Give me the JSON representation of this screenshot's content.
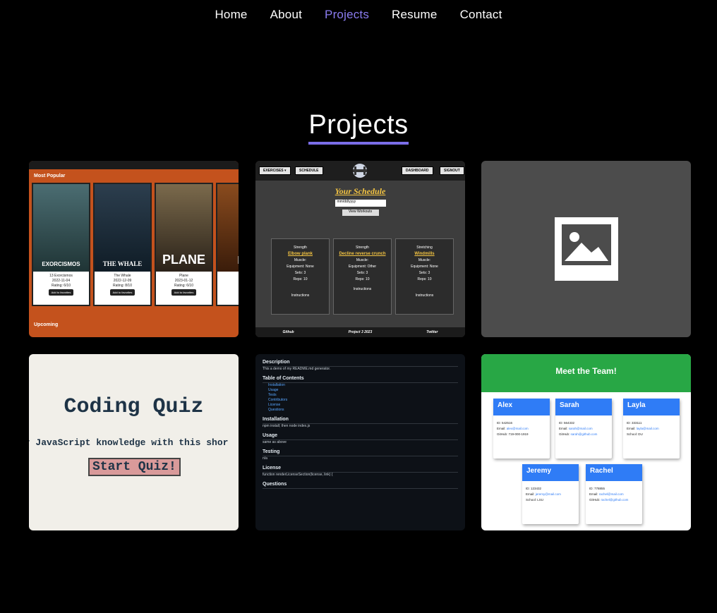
{
  "nav": {
    "items": [
      "Home",
      "About",
      "Projects",
      "Resume",
      "Contact"
    ],
    "active": "Projects"
  },
  "page_title": "Projects",
  "colors": {
    "accent": "#7b6ee8",
    "active_link": "#8a7cf0",
    "background": "#000000"
  },
  "projects": [
    {
      "sections": [
        "Most Popular",
        "Upcoming"
      ],
      "movies": [
        {
          "title": "13 Exorcismos",
          "poster_text": "EXORCISMOS",
          "date": "2022-11-04",
          "rating": "Rating: 6/10"
        },
        {
          "title": "The Whale",
          "poster_text": "THE WHALE",
          "date": "2022-12-09",
          "rating": "Rating: 8/10"
        },
        {
          "title": "Plane",
          "poster_text": "PLANE",
          "date": "2023-01-12",
          "rating": "Rating: 6/10"
        },
        {
          "title": "",
          "poster_text": "DE",
          "date": "",
          "rating": ""
        }
      ],
      "favorite_button": "Add to favorites"
    },
    {
      "nav": [
        "EXERCISES ▾",
        "SCHEDULE",
        "DASHBOARD",
        "SIGNOUT"
      ],
      "heading": "Your Schedule",
      "date_placeholder": "mm/dd/yyyy",
      "view_button": "View Workouts",
      "exercises": [
        {
          "type": "Strength",
          "name": "Elbow plank",
          "muscle": "Muscle:",
          "equipment": "Equipment: None",
          "sets": "Sets: 3",
          "reps": "Reps: 10"
        },
        {
          "type": "Strength",
          "name": "Decline reverse crunch",
          "muscle": "Muscle:",
          "equipment": "Equipment: Other",
          "sets": "Sets: 3",
          "reps": "Reps: 10"
        },
        {
          "type": "Stretching",
          "name": "Windmills",
          "muscle": "Muscle:",
          "equipment": "Equipment: None",
          "sets": "Sets: 3",
          "reps": "Reps: 10"
        }
      ],
      "instructions_button": "Instructions",
      "footer": [
        "Github",
        "Project 3 2023",
        "Twitter"
      ]
    },
    {
      "placeholder_icon": "image-placeholder-icon"
    },
    {
      "title": "Coding Quiz",
      "subtitle": "ur JavaScript knowledge with this shor",
      "start_button": "Start Quiz!"
    },
    {
      "sections": [
        {
          "heading": "Description",
          "body": "This a demo of my README.md generator."
        },
        {
          "heading": "Table of Contents",
          "links": [
            "Installation",
            "Usage",
            "Tests",
            "Contributors",
            "License",
            "Questions"
          ]
        },
        {
          "heading": "Installation",
          "body": "npm install; then node index.js"
        },
        {
          "heading": "Usage",
          "body": "same as above"
        },
        {
          "heading": "Testing",
          "body": "n/a"
        },
        {
          "heading": "License",
          "body": "function renderLicenseSection(license, link) {"
        },
        {
          "heading": "Questions",
          "body": ""
        }
      ]
    },
    {
      "heading": "Meet the Team!",
      "members": [
        {
          "name": "Alex",
          "id": "ID: 542516",
          "email": "alex@mail.com",
          "extra_label": "GitHub:",
          "extra_value": "719-000-1919"
        },
        {
          "name": "Sarah",
          "id": "ID: 564332",
          "email": "sarah@mail.com",
          "extra_label": "GitHub:",
          "extra_value": "sarah@github.com"
        },
        {
          "name": "Layla",
          "id": "ID: 333111",
          "email": "layla@mail.com",
          "extra_label": "School:",
          "extra_value": "DU"
        },
        {
          "name": "Jeremy",
          "id": "ID: 123432",
          "email": "jeremy@mail.com",
          "extra_label": "School:",
          "extra_value": "LSU"
        },
        {
          "name": "Rachel",
          "id": "ID: 778855",
          "email": "rachel@mail.com",
          "extra_label": "GitHub:",
          "extra_value": "rachel@github.com"
        }
      ]
    }
  ]
}
